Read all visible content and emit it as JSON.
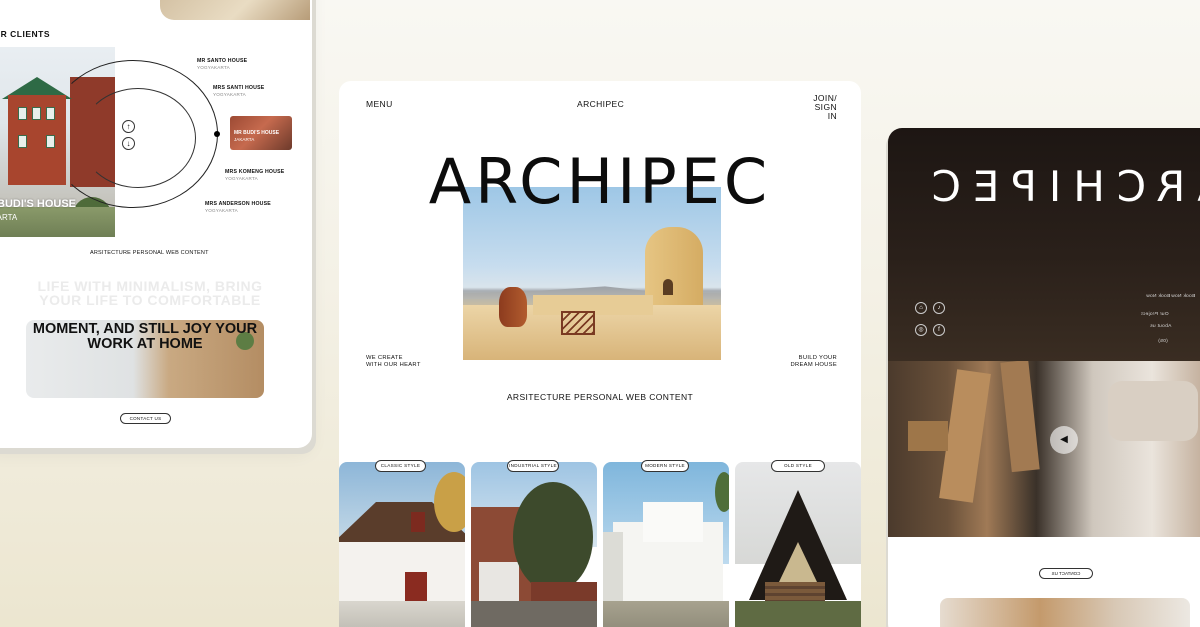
{
  "left_card": {
    "clients_title": "UR CLIENTS",
    "featured_caption": "R BUDI'S HOUSE",
    "featured_sub": "AKARTA",
    "clients": [
      {
        "name": "MR SANTO HOUSE",
        "city": "YOGYAKARTA"
      },
      {
        "name": "MRS SANTI HOUSE",
        "city": "YOGYAKARTA"
      },
      {
        "name": "MR BUDI'S HOUSE",
        "city": "JAKARTA"
      },
      {
        "name": "MRS KOMENG HOUSE",
        "city": "YOGYAKARTA"
      },
      {
        "name": "MRS ANDERSON HOUSE",
        "city": "YOGYAKARTA"
      }
    ],
    "arrow_up": "↑",
    "arrow_down": "↓",
    "tagline": "ARSITECTURE PERSONAL WEB CONTENT",
    "ghost_text": "LIFE WITH MINIMALISM, BRING YOUR LIFE TO COMFORTABLE",
    "panel_text": "MOMENT, AND STILL JOY YOUR WORK AT HOME",
    "contact_label": "CONTACT US"
  },
  "center_card": {
    "nav": {
      "menu": "MENU",
      "brand": "ARCHIPEC",
      "join": "JOIN/",
      "sign_in": "SIGN IN"
    },
    "hero_title": "ARCHIPEC",
    "left_caption_1": "WE CREATE",
    "left_caption_2": "WITH OUR HEART",
    "right_caption_1": "BUILD YOUR",
    "right_caption_2": "DREAM HOUSE",
    "tagline": "ARSITECTURE PERSONAL WEB CONTENT",
    "styles": [
      "CLASSIC STYLE",
      "INDUSTRIAL STYLE",
      "MODERN STYLE",
      "OLD STYLE"
    ]
  },
  "right_card": {
    "mirrored_title": "ARCHIPEC",
    "menu_items": [
      "Book Now",
      "Book Now",
      "Our Project",
      "About us"
    ],
    "page_number": "(05)",
    "play_glyph": "◀",
    "contact_label": "CONTACT US"
  }
}
